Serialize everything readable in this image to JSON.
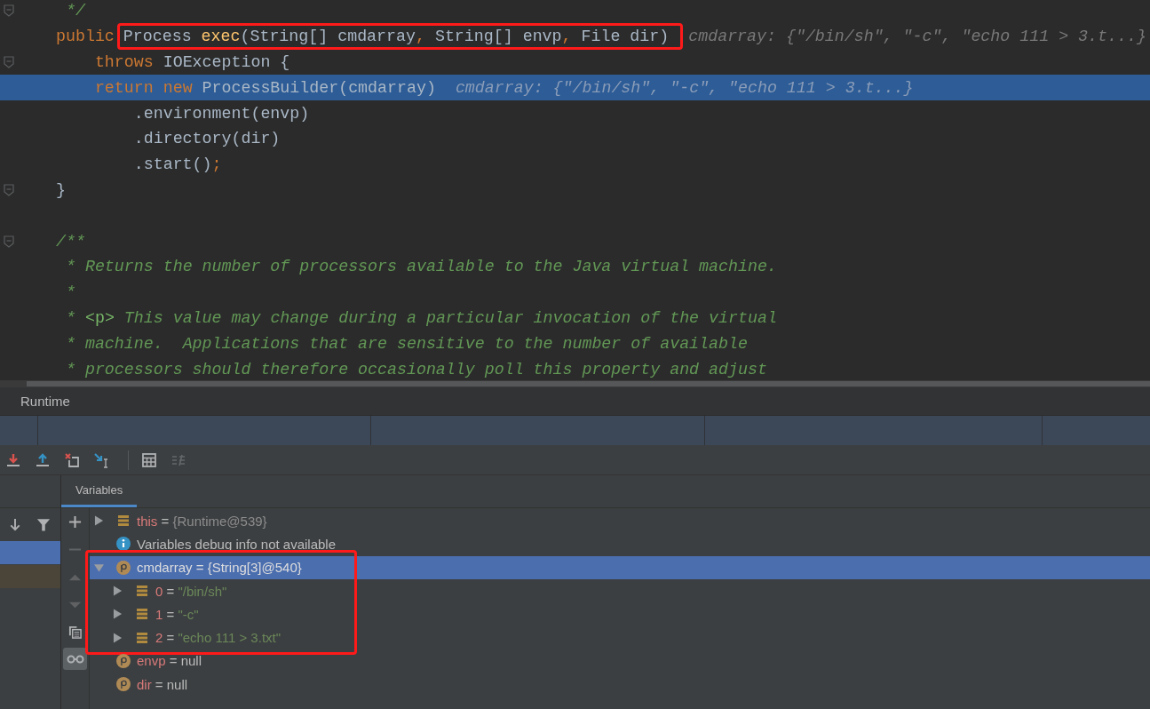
{
  "editor": {
    "lines": [
      {
        "fold": true,
        "current": false,
        "segments": [
          {
            "kind": "code",
            "tokens": [
              {
                "kind": "doc",
                "text": " */"
              }
            ]
          }
        ]
      },
      {
        "fold": false,
        "current": false,
        "segments": [
          {
            "kind": "code",
            "tokens": [
              {
                "kind": "keyword",
                "text": "public"
              }
            ]
          },
          {
            "kind": "outlined",
            "tokens": [
              {
                "kind": "plain",
                "text": "Process "
              },
              {
                "kind": "method",
                "text": "exec"
              },
              {
                "kind": "plain",
                "text": "(String[] cmdarray"
              },
              {
                "kind": "keyword",
                "text": ", "
              },
              {
                "kind": "plain",
                "text": "String[] envp"
              },
              {
                "kind": "keyword",
                "text": ", "
              },
              {
                "kind": "plain",
                "text": "File dir)"
              }
            ]
          },
          {
            "kind": "hint",
            "text": "cmdarray: {\"/bin/sh\", \"-c\", \"echo 111 > 3.t...}"
          }
        ]
      },
      {
        "fold": true,
        "current": false,
        "segments": [
          {
            "kind": "code",
            "tokens": [
              {
                "kind": "keyword",
                "text": "    throws "
              },
              {
                "kind": "plain",
                "text": "IOException {"
              }
            ]
          }
        ]
      },
      {
        "fold": false,
        "current": true,
        "segments": [
          {
            "kind": "code",
            "tokens": [
              {
                "kind": "keyword",
                "text": "    return new "
              },
              {
                "kind": "plain",
                "text": "ProcessBuilder(cmdarray)"
              }
            ]
          },
          {
            "kind": "hint",
            "text": "cmdarray: {\"/bin/sh\", \"-c\", \"echo 111 > 3.t...}"
          }
        ]
      },
      {
        "fold": false,
        "current": false,
        "segments": [
          {
            "kind": "code",
            "tokens": [
              {
                "kind": "plain",
                "text": "        .environment(envp)"
              }
            ]
          }
        ]
      },
      {
        "fold": false,
        "current": false,
        "segments": [
          {
            "kind": "code",
            "tokens": [
              {
                "kind": "plain",
                "text": "        .directory(dir)"
              }
            ]
          }
        ]
      },
      {
        "fold": false,
        "current": false,
        "segments": [
          {
            "kind": "code",
            "tokens": [
              {
                "kind": "plain",
                "text": "        .start()"
              },
              {
                "kind": "keyword",
                "text": ";"
              }
            ]
          }
        ]
      },
      {
        "fold": true,
        "current": false,
        "segments": [
          {
            "kind": "code",
            "tokens": [
              {
                "kind": "plain",
                "text": "}"
              }
            ]
          }
        ]
      },
      {
        "fold": false,
        "current": false
      },
      {
        "fold": true,
        "current": false,
        "segments": [
          {
            "kind": "code",
            "tokens": [
              {
                "kind": "doc",
                "text": "/**"
              }
            ]
          }
        ]
      },
      {
        "fold": false,
        "current": false,
        "segments": [
          {
            "kind": "code",
            "tokens": [
              {
                "kind": "doc",
                "text": " * Returns the number of processors available to the Java virtual machine."
              }
            ]
          }
        ]
      },
      {
        "fold": false,
        "current": false,
        "segments": [
          {
            "kind": "code",
            "tokens": [
              {
                "kind": "doc",
                "text": " *"
              }
            ]
          }
        ]
      },
      {
        "fold": false,
        "current": false,
        "segments": [
          {
            "kind": "code",
            "tokens": [
              {
                "kind": "doc",
                "text": " * "
              },
              {
                "kind": "doc_tag",
                "text": "<p>"
              },
              {
                "kind": "doc",
                "text": " This value may change during a particular invocation of the virtual"
              }
            ]
          }
        ]
      },
      {
        "fold": false,
        "current": false,
        "segments": [
          {
            "kind": "code",
            "tokens": [
              {
                "kind": "doc",
                "text": " * machine.  Applications that are sensitive to the number of available"
              }
            ]
          }
        ]
      },
      {
        "fold": false,
        "current": false,
        "segments": [
          {
            "kind": "code",
            "tokens": [
              {
                "kind": "doc",
                "text": " * processors should therefore occasionally poll this property and adjust"
              }
            ]
          }
        ]
      }
    ]
  },
  "debug": {
    "title": "Runtime",
    "toolbar": [
      {
        "kind": "step_into_red",
        "disabled": false
      },
      {
        "kind": "step_out",
        "disabled": false
      },
      {
        "kind": "drop_frame",
        "disabled": false
      },
      {
        "kind": "run_to_cursor",
        "disabled": false
      },
      {
        "kind": "evaluate",
        "disabled": false
      },
      {
        "kind": "trace",
        "disabled": true
      }
    ],
    "frames": [
      {
        "selected": true,
        "library": false
      },
      {
        "selected": false,
        "library": true
      }
    ],
    "tabs": [
      {
        "label": "Variables",
        "selected": true
      }
    ],
    "side_tools": [
      {
        "kind": "add",
        "disabled": false,
        "on": false
      },
      {
        "kind": "remove",
        "disabled": true,
        "on": false
      },
      {
        "kind": "up",
        "disabled": true,
        "on": false
      },
      {
        "kind": "down",
        "disabled": true,
        "on": false
      },
      {
        "kind": "copy",
        "disabled": false,
        "on": false
      },
      {
        "kind": "watches",
        "disabled": false,
        "on": true
      }
    ],
    "variables": [
      {
        "kind": "field",
        "name": "this",
        "operator": "=",
        "value": "{Runtime@539}",
        "color": "#8c8c8c",
        "expanded": false,
        "selected": false,
        "outlined": false
      },
      {
        "kind": "info",
        "text": "Variables debug info not available",
        "selected": false,
        "outlined": false
      },
      {
        "kind": "param",
        "name": "cmdarray",
        "operator": "=",
        "value": "{String[3]@540}",
        "color": "#dddddd",
        "expanded": true,
        "selected": true,
        "outlined": true,
        "children": [
          {
            "kind": "field",
            "name": "0",
            "operator": "=",
            "value": "\"/bin/sh\"",
            "color": "#6a8759",
            "expanded": false,
            "selected": false
          },
          {
            "kind": "field",
            "name": "1",
            "operator": "=",
            "value": "\"-c\"",
            "color": "#6a8759",
            "expanded": false,
            "selected": false
          },
          {
            "kind": "field",
            "name": "2",
            "operator": "=",
            "value": "\"echo 111 > 3.txt\"",
            "color": "#6a8759",
            "expanded": false,
            "selected": false
          }
        ]
      },
      {
        "kind": "param",
        "name": "envp",
        "operator": "=",
        "value": "null",
        "color": "#bbbbbb",
        "selected": false,
        "outlined": false
      },
      {
        "kind": "param",
        "name": "dir",
        "operator": "=",
        "value": "null",
        "color": "#bbbbbb",
        "selected": false,
        "outlined": false
      }
    ]
  }
}
